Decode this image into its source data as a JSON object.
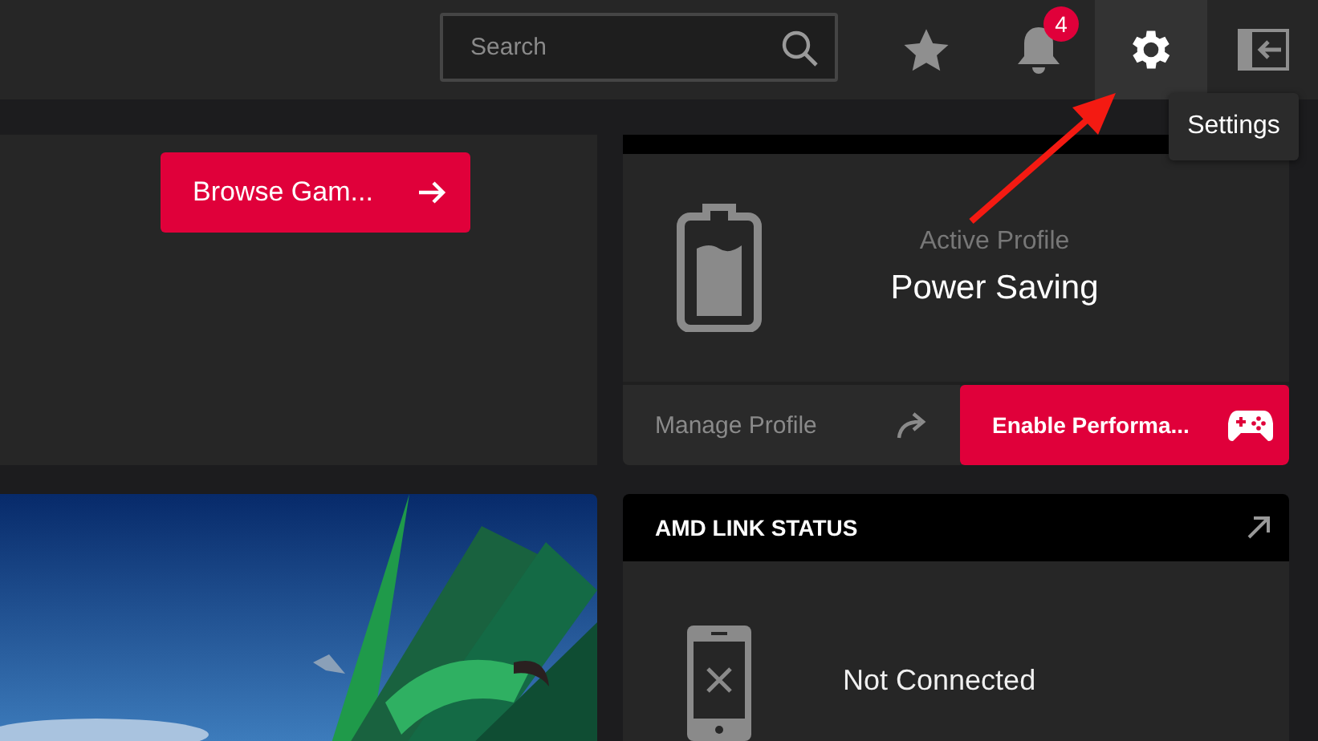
{
  "search": {
    "placeholder": "Search"
  },
  "toolbar": [
    {
      "kind": "favorites",
      "hovered": false
    },
    {
      "kind": "notifications",
      "hovered": false,
      "badge": "4"
    },
    {
      "kind": "settings",
      "hovered": true
    },
    {
      "kind": "exit",
      "hovered": false
    }
  ],
  "tooltip": {
    "text": "Settings"
  },
  "browse_button": {
    "label": "Browse Gam..."
  },
  "profile": {
    "caption": "Active Profile",
    "name": "Power Saving",
    "manage": "Manage Profile",
    "enable_button": "Enable Performa..."
  },
  "link_status": {
    "title": "AMD LINK STATUS",
    "status": "Not Connected"
  }
}
